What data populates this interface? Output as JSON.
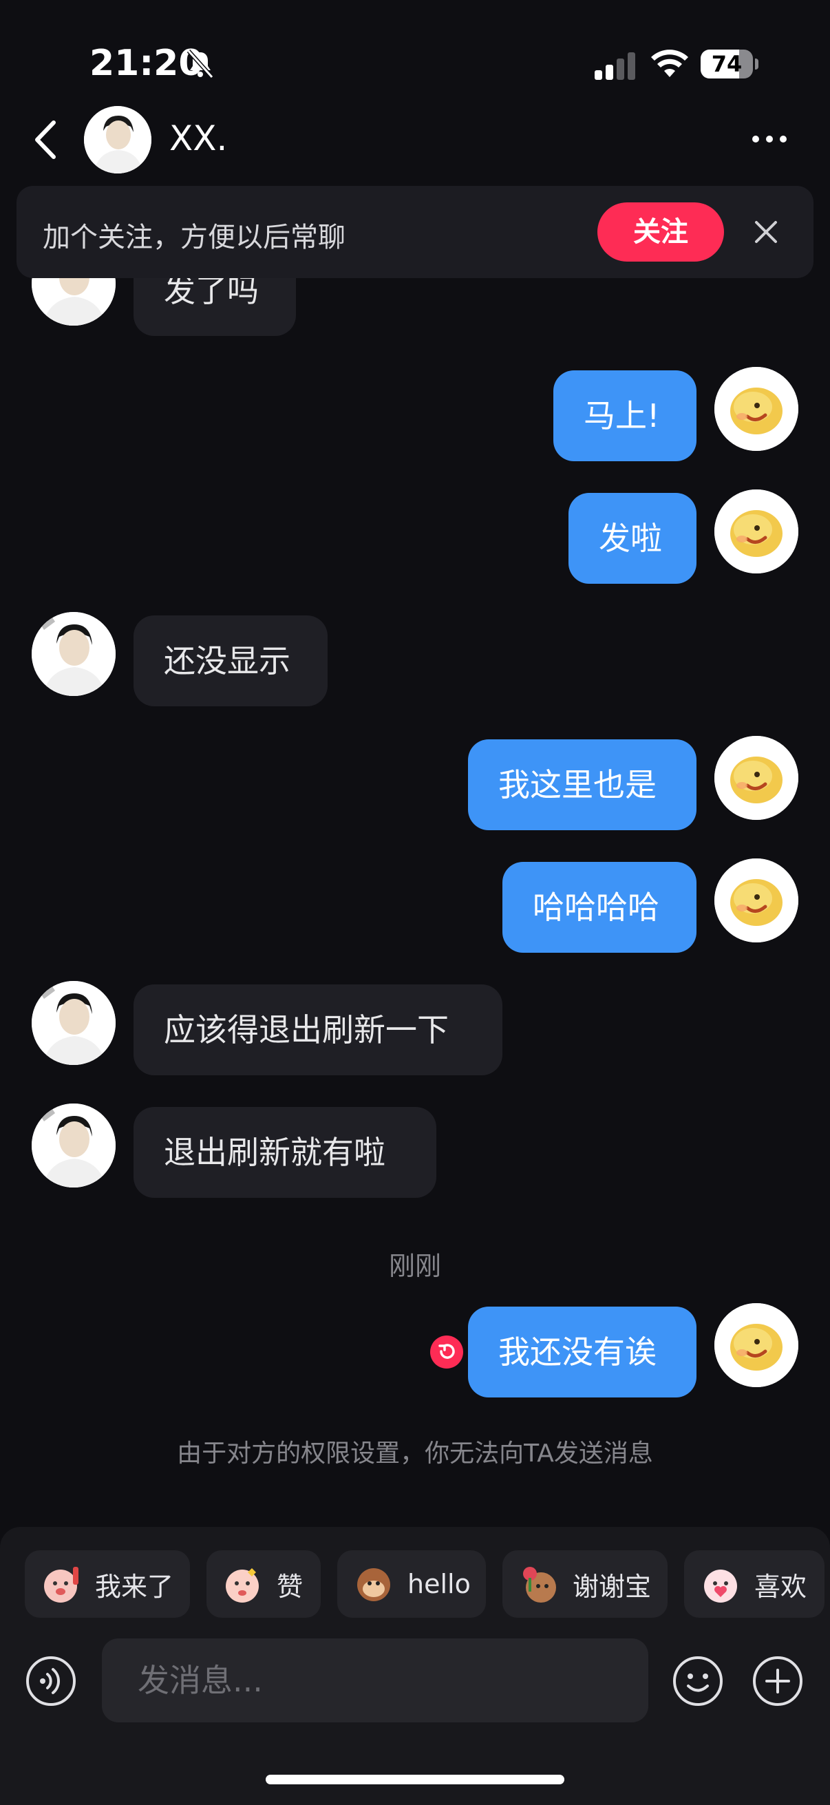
{
  "status_bar": {
    "time": "21:20",
    "battery_percent": 74,
    "battery_text": "74"
  },
  "header": {
    "contact_name": "XX."
  },
  "follow_banner": {
    "text": "加个关注，方便以后常聊",
    "button_label": "关注"
  },
  "messages": [
    {
      "from": "other",
      "text": "发了吗"
    },
    {
      "from": "self",
      "text": "马上!"
    },
    {
      "from": "self",
      "text": "发啦"
    },
    {
      "from": "other",
      "text": "还没显示"
    },
    {
      "from": "self",
      "text": "我这里也是"
    },
    {
      "from": "self",
      "text": "哈哈哈哈"
    },
    {
      "from": "other",
      "text": "应该得退出刷新一下"
    },
    {
      "from": "other",
      "text": "退出刷新就有啦"
    },
    {
      "from": "self",
      "text": "我还没有诶",
      "failed": true
    }
  ],
  "time_divider": "刚刚",
  "notice": "由于对方的权限设置，你无法向TA发送消息",
  "quick_replies": [
    {
      "label": "我来了",
      "icon": "sticker-wave-icon"
    },
    {
      "label": "赞",
      "icon": "sticker-thumbs-icon"
    },
    {
      "label": "hello",
      "icon": "sticker-monkey-icon"
    },
    {
      "label": "谢谢宝",
      "icon": "sticker-rose-icon"
    },
    {
      "label": "喜欢",
      "icon": "sticker-heart-icon"
    }
  ],
  "input": {
    "placeholder": "发消息..."
  },
  "colors": {
    "background": "#0e0e12",
    "self_bubble": "#3e94f7",
    "other_bubble": "#1f1f25",
    "follow_button": "#fe2c55"
  }
}
